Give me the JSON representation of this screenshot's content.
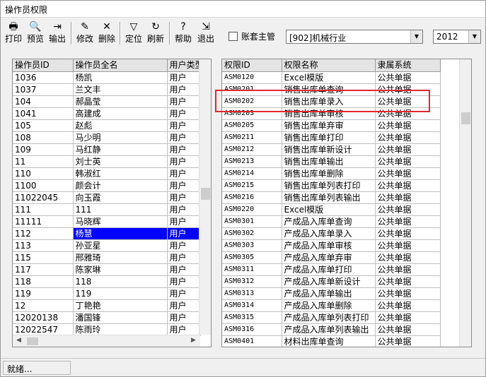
{
  "window": {
    "title": "操作员权限"
  },
  "toolbar": {
    "buttons": [
      {
        "label": "打印",
        "icon": "printer-icon"
      },
      {
        "label": "预览",
        "icon": "preview-icon"
      },
      {
        "label": "输出",
        "icon": "export-icon"
      },
      {
        "label": "修改",
        "icon": "edit-icon"
      },
      {
        "label": "删除",
        "icon": "delete-icon"
      },
      {
        "label": "定位",
        "icon": "filter-icon"
      },
      {
        "label": "刷新",
        "icon": "refresh-icon"
      },
      {
        "label": "帮助",
        "icon": "help-icon"
      },
      {
        "label": "退出",
        "icon": "exit-icon"
      }
    ],
    "account_master_label": "账套主管",
    "account_master_checked": false,
    "account_select": "[902]机械行业",
    "year_select": "2012"
  },
  "operators": {
    "columns": [
      "操作员ID",
      "操作员全名",
      "用户类型"
    ],
    "selected_index": 13,
    "rows": [
      [
        "1036",
        "杨凯",
        "用户"
      ],
      [
        "1037",
        "兰文丰",
        "用户"
      ],
      [
        "104",
        "郝晶莹",
        "用户"
      ],
      [
        "1041",
        "高建成",
        "用户"
      ],
      [
        "105",
        "赵彪",
        "用户"
      ],
      [
        "108",
        "马少明",
        "用户"
      ],
      [
        "109",
        "马红静",
        "用户"
      ],
      [
        "11",
        "刘士英",
        "用户"
      ],
      [
        "110",
        "韩淑红",
        "用户"
      ],
      [
        "1100",
        "颜会计",
        "用户"
      ],
      [
        "11022045",
        "向玉霞",
        "用户"
      ],
      [
        "111",
        "111",
        "用户"
      ],
      [
        "11111",
        "马晓辉",
        "用户"
      ],
      [
        "112",
        "杨慧",
        "用户"
      ],
      [
        "113",
        "孙亚星",
        "用户"
      ],
      [
        "115",
        "邢雅琦",
        "用户"
      ],
      [
        "117",
        "陈家琳",
        "用户"
      ],
      [
        "118",
        "118",
        "用户"
      ],
      [
        "119",
        "119",
        "用户"
      ],
      [
        "12",
        "丁艳艳",
        "用户"
      ],
      [
        "12020138",
        "潘国锋",
        "用户"
      ],
      [
        "12022547",
        "陈雨玲",
        "用户"
      ]
    ]
  },
  "permissions": {
    "columns": [
      "权限ID",
      "权限名称",
      "隶属系统"
    ],
    "rows": [
      [
        "ASM0120",
        "Excel模版",
        "公共单据"
      ],
      [
        "ASM0201",
        "销售出库单查询",
        "公共单据"
      ],
      [
        "ASM0202",
        "销售出库单录入",
        "公共单据"
      ],
      [
        "ASM0203",
        "销售出库单审核",
        "公共单据"
      ],
      [
        "ASM0205",
        "销售出库单弃审",
        "公共单据"
      ],
      [
        "ASM0211",
        "销售出库单打印",
        "公共单据"
      ],
      [
        "ASM0212",
        "销售出库单新设计",
        "公共单据"
      ],
      [
        "ASM0213",
        "销售出库单输出",
        "公共单据"
      ],
      [
        "ASM0214",
        "销售出库单删除",
        "公共单据"
      ],
      [
        "ASM0215",
        "销售出库单列表打印",
        "公共单据"
      ],
      [
        "ASM0216",
        "销售出库单列表输出",
        "公共单据"
      ],
      [
        "ASM0220",
        "Excel模版",
        "公共单据"
      ],
      [
        "ASM0301",
        "产成品入库单查询",
        "公共单据"
      ],
      [
        "ASM0302",
        "产成品入库单录入",
        "公共单据"
      ],
      [
        "ASM0303",
        "产成品入库单审核",
        "公共单据"
      ],
      [
        "ASM0305",
        "产成品入库单弃审",
        "公共单据"
      ],
      [
        "ASM0311",
        "产成品入库单打印",
        "公共单据"
      ],
      [
        "ASM0312",
        "产成品入库单新设计",
        "公共单据"
      ],
      [
        "ASM0313",
        "产成品入库单输出",
        "公共单据"
      ],
      [
        "ASM0314",
        "产成品入库单删除",
        "公共单据"
      ],
      [
        "ASM0315",
        "产成品入库单列表打印",
        "公共单据"
      ],
      [
        "ASM0316",
        "产成品入库单列表输出",
        "公共单据"
      ],
      [
        "ASM0401",
        "材料出库单查询",
        "公共单据"
      ]
    ]
  },
  "status": {
    "text": "就绪..."
  },
  "colors": {
    "selection": "#0000ff",
    "highlight_box": "#e0282f"
  }
}
